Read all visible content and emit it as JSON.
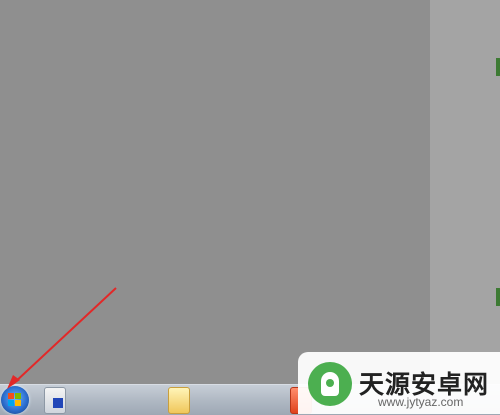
{
  "desktop": {
    "background": "#8f8f8f",
    "side_panel_color": "#a4a4a4",
    "status_dot_color": "#3d7a33"
  },
  "taskbar": {
    "start_button_icon": "windows-start-icon",
    "pinned_icons": [
      "file-explorer-icon",
      "folder-icon",
      "media-player-icon"
    ]
  },
  "annotation": {
    "icon": "red-arrow-icon",
    "color": "#e22828",
    "target": "start-button"
  },
  "watermark": {
    "brand": "天源安卓网",
    "url": "www.jytyaz.com",
    "logo_icon": "android-logo-icon",
    "logo_color": "#4caf50"
  }
}
